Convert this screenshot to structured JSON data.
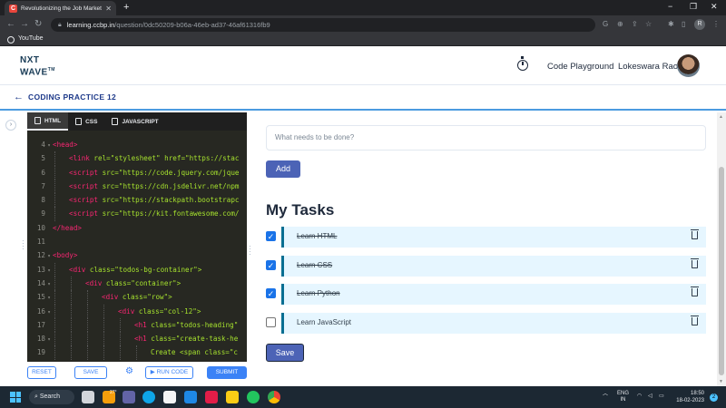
{
  "browser": {
    "tab_title": "Revolutionizing the Job Market |",
    "favicon_text": "C",
    "url_host": "learning.ccbp.in",
    "url_path": "/question/0dc50209-b06a-46eb-ad37-46af61316fb9",
    "profile_initial": "R",
    "bookmark_label": "YouTube"
  },
  "header": {
    "logo_line1": "NXT",
    "logo_line2": "WAVE",
    "logo_tm": "TM",
    "code_playground": "Code Playground",
    "user_name": "Lokeswara Rao"
  },
  "practice": {
    "title": "CODING PRACTICE 12"
  },
  "editor": {
    "tabs": [
      {
        "label": "HTML",
        "icon": "html5-icon",
        "active": true
      },
      {
        "label": "CSS",
        "icon": "css3-icon",
        "active": false
      },
      {
        "label": "JAVASCRIPT",
        "icon": "js-file-icon",
        "active": false
      }
    ],
    "lines": [
      {
        "n": "4",
        "fold": true,
        "indent": 0,
        "tag": "<head>",
        "rest": ""
      },
      {
        "n": "5",
        "fold": false,
        "indent": 1,
        "tag": "<link",
        "rest": " rel=\"stylesheet\" href=\"https://stac"
      },
      {
        "n": "6",
        "fold": false,
        "indent": 1,
        "tag": "<script",
        "rest": " src=\"https://code.jquery.com/jque"
      },
      {
        "n": "7",
        "fold": false,
        "indent": 1,
        "tag": "<script",
        "rest": " src=\"https://cdn.jsdelivr.net/npm"
      },
      {
        "n": "8",
        "fold": false,
        "indent": 1,
        "tag": "<script",
        "rest": " src=\"https://stackpath.bootstrapc"
      },
      {
        "n": "9",
        "fold": false,
        "indent": 1,
        "tag": "<script",
        "rest": " src=\"https://kit.fontawesome.com/"
      },
      {
        "n": "10",
        "fold": false,
        "indent": 0,
        "tag": "</head>",
        "rest": ""
      },
      {
        "n": "11",
        "fold": false,
        "indent": 0,
        "tag": "",
        "rest": ""
      },
      {
        "n": "12",
        "fold": true,
        "indent": 0,
        "tag": "<body>",
        "rest": ""
      },
      {
        "n": "13",
        "fold": true,
        "indent": 1,
        "tag": "<div",
        "rest": " class=\"todos-bg-container\">"
      },
      {
        "n": "14",
        "fold": true,
        "indent": 2,
        "tag": "<div",
        "rest": " class=\"container\">"
      },
      {
        "n": "15",
        "fold": true,
        "indent": 3,
        "tag": "<div",
        "rest": " class=\"row\">"
      },
      {
        "n": "16",
        "fold": true,
        "indent": 4,
        "tag": "<div",
        "rest": " class=\"col-12\">"
      },
      {
        "n": "17",
        "fold": false,
        "indent": 5,
        "tag": "<h1",
        "rest": " class=\"todos-heading\""
      },
      {
        "n": "18",
        "fold": true,
        "indent": 5,
        "tag": "<h1",
        "rest": " class=\"create-task-he"
      },
      {
        "n": "19",
        "fold": false,
        "indent": 6,
        "tag": "",
        "rest": "Create <span class=\"c"
      }
    ],
    "buttons": {
      "reset": "RESET",
      "save": "SAVE",
      "run": "RUN CODE",
      "submit": "SUBMIT"
    }
  },
  "output": {
    "input_placeholder": "What needs to be done?",
    "add_label": "Add",
    "heading_bold": "My",
    "heading_rest": " Tasks",
    "tasks": [
      {
        "label": "Learn HTML",
        "checked": true
      },
      {
        "label": "Learn CSS",
        "checked": true
      },
      {
        "label": "Learn Python",
        "checked": true
      },
      {
        "label": "Learn JavaScript",
        "checked": false
      }
    ],
    "save_label": "Save"
  },
  "taskbar": {
    "search_label": "Search",
    "weather": "27°",
    "lang_line1": "ENG",
    "lang_line2": "IN",
    "time": "18:50",
    "date": "18-02-2023",
    "notification_count": "2"
  },
  "colors": {
    "primary_button": "#4c63b6",
    "task_bg": "#e6f6ff",
    "task_border": "#096f92",
    "practice_title": "#1e3a8a",
    "checkbox_checked": "#1a73e8"
  }
}
